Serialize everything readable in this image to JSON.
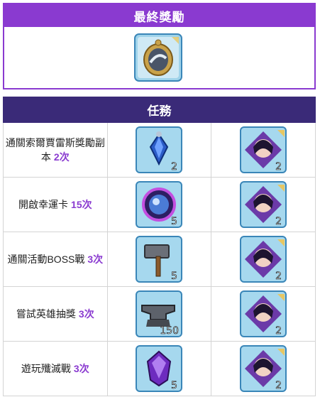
{
  "final_reward": {
    "title": "最終獎勵",
    "item_icon": "golden-mirror-icon"
  },
  "tasks": {
    "header": "任務",
    "rows": [
      {
        "text": "通關索爾賈雷斯獎勵副本",
        "count": "2次",
        "rewards": [
          {
            "icon": "blue-amulet-icon",
            "qty": "2"
          },
          {
            "icon": "hero-portrait-icon",
            "qty": "2"
          }
        ]
      },
      {
        "text": "開啟幸運卡",
        "count": "15次",
        "rewards": [
          {
            "icon": "magic-orb-icon",
            "qty": "5"
          },
          {
            "icon": "hero-portrait-icon",
            "qty": "2"
          }
        ]
      },
      {
        "text": "通關活動BOSS戰",
        "count": "3次",
        "rewards": [
          {
            "icon": "hammer-icon",
            "qty": "5"
          },
          {
            "icon": "hero-portrait-icon",
            "qty": "2"
          }
        ]
      },
      {
        "text": "嘗試英雄抽獎",
        "count": "3次",
        "rewards": [
          {
            "icon": "anvil-icon",
            "qty": "150"
          },
          {
            "icon": "hero-portrait-icon",
            "qty": "2"
          }
        ]
      },
      {
        "text": "遊玩殲滅戰",
        "count": "3次",
        "rewards": [
          {
            "icon": "purple-gem-icon",
            "qty": "5"
          },
          {
            "icon": "hero-portrait-icon",
            "qty": "2"
          }
        ]
      }
    ]
  }
}
